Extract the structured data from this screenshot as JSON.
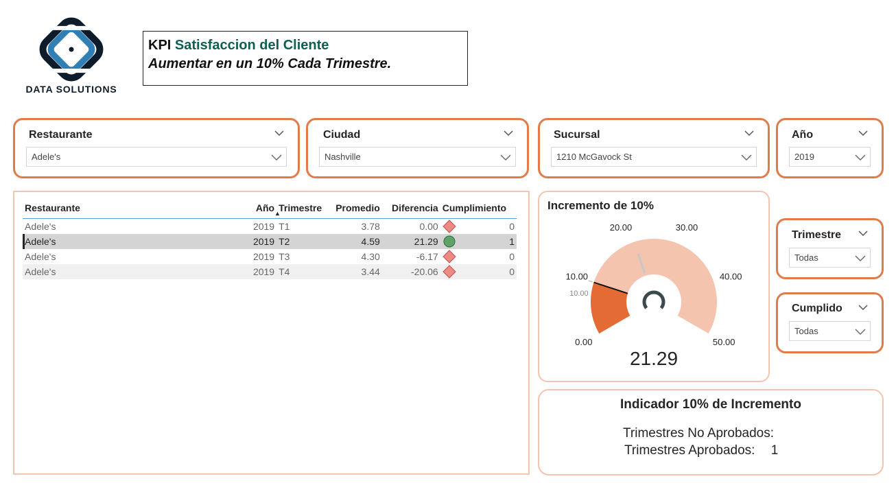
{
  "brand": {
    "name": "DATA SOLUTIONS",
    "colors": {
      "dark": "#0d1b2a",
      "blue": "#2f7fb5"
    }
  },
  "kpi": {
    "prefix": "KPI",
    "subject": "Satisfaccion del Cliente",
    "goal": "Aumentar en un 10% Cada Trimestre."
  },
  "slicers": {
    "restaurante": {
      "title": "Restaurante",
      "value": "Adele's"
    },
    "ciudad": {
      "title": "Ciudad",
      "value": "Nashville"
    },
    "sucursal": {
      "title": "Sucursal",
      "value": "1210 McGavock St"
    },
    "anio": {
      "title": "Año",
      "value": "2019"
    },
    "trimestre": {
      "title": "Trimestre",
      "value": "Todas"
    },
    "cumplido": {
      "title": "Cumplido",
      "value": "Todas"
    }
  },
  "table": {
    "headers": [
      "Restaurante",
      "Año",
      "Trimestre",
      "Promedio",
      "Diferencia",
      "Cumplimiento"
    ],
    "sorted_column": "Trimestre",
    "rows": [
      {
        "restaurante": "Adele's",
        "anio": "2019",
        "trimestre": "T1",
        "promedio": "3.78",
        "diferencia": "0.00",
        "icon": "red-diamond-icon",
        "cumplimiento": "0"
      },
      {
        "restaurante": "Adele's",
        "anio": "2019",
        "trimestre": "T2",
        "promedio": "4.59",
        "diferencia": "21.29",
        "icon": "green-circle-icon",
        "cumplimiento": "1"
      },
      {
        "restaurante": "Adele's",
        "anio": "2019",
        "trimestre": "T3",
        "promedio": "4.30",
        "diferencia": "-6.17",
        "icon": "red-diamond-icon",
        "cumplimiento": "0"
      },
      {
        "restaurante": "Adele's",
        "anio": "2019",
        "trimestre": "T4",
        "promedio": "3.44",
        "diferencia": "-20.06",
        "icon": "red-diamond-icon",
        "cumplimiento": "0"
      }
    ],
    "selected_row": 1
  },
  "gauge": {
    "title": "Incremento de 10%",
    "min": 0,
    "max": 50,
    "value": 21.29,
    "value_label": "21.29",
    "target": 10,
    "target_label": "10.00",
    "filled_value": 10,
    "tick_labels": [
      "0.00",
      "10.00",
      "20.00",
      "30.00",
      "40.00",
      "50.00"
    ],
    "colors": {
      "fill": "#e56b35",
      "track": "#f4c4ae",
      "needle": "#c8c8c8",
      "target": "#111111",
      "hub": "#3a4a4e"
    }
  },
  "indicator": {
    "title": "Indicador 10% de Incremento",
    "no_aprobados_label": "Trimestres No Aprobados:",
    "no_aprobados_value": "",
    "aprobados_label": "Trimestres Aprobados:",
    "aprobados_value": "1"
  },
  "colors": {
    "accent": "#e07b4a",
    "panel_border": "#f4c4ae",
    "teal_text": "#0e5e52"
  }
}
